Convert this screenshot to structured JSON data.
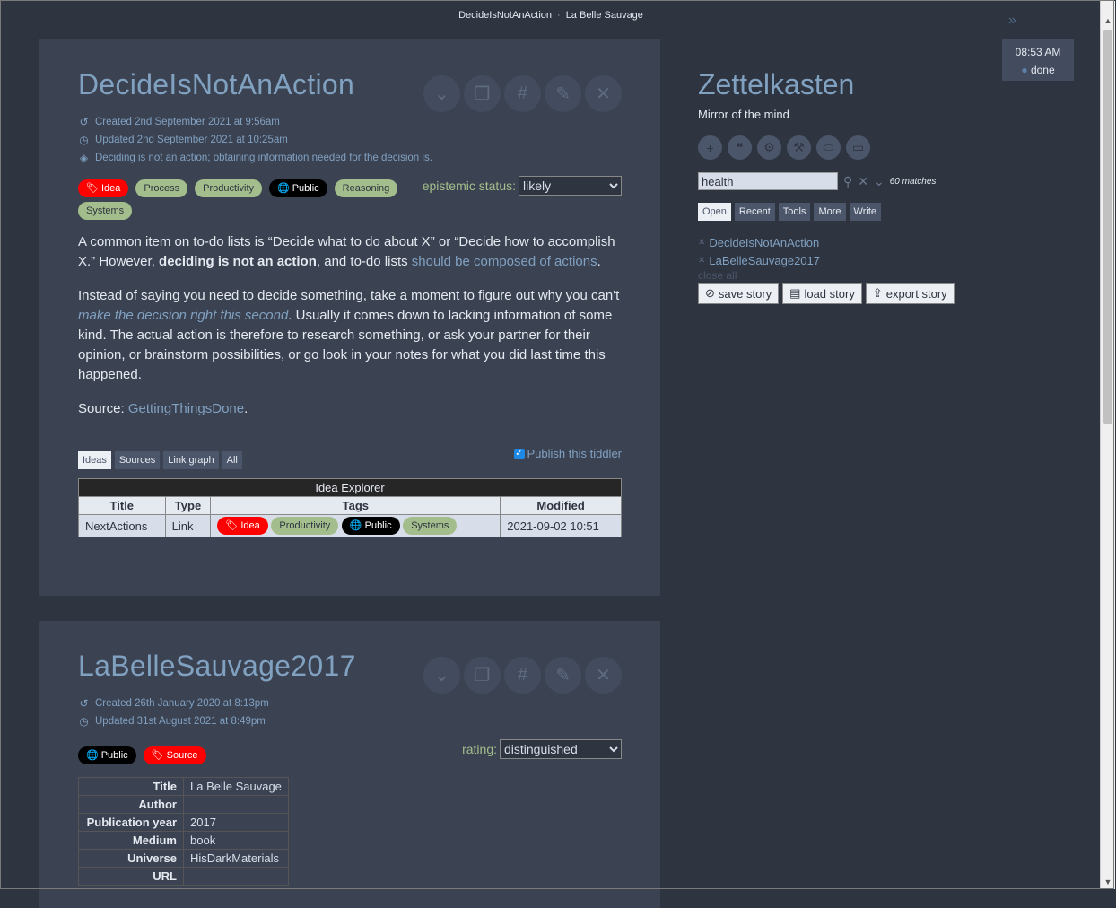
{
  "window": {
    "title_left": "DecideIsNotAnAction",
    "separator": "·",
    "title_right": "La Belle Sauvage"
  },
  "clock": {
    "time": "08:53 AM",
    "status": "done"
  },
  "tiddler1": {
    "title": "DecideIsNotAnAction",
    "created": "Created 2nd September 2021 at 9:56am",
    "updated": "Updated 2nd September 2021 at 10:25am",
    "summary": "Deciding is not an action; obtaining information needed for the decision is.",
    "tags": [
      {
        "label": "Idea",
        "color": "#ff0000"
      },
      {
        "label": "Process",
        "color": "#a3be8c"
      },
      {
        "label": "Productivity",
        "color": "#a3be8c"
      },
      {
        "label": "Public",
        "color": "#000000"
      },
      {
        "label": "Reasoning",
        "color": "#a3be8c"
      },
      {
        "label": "Systems",
        "color": "#a3be8c"
      }
    ],
    "epistemic_label": "epistemic status:",
    "epistemic_value": "likely",
    "p1_a": "A common item on to-do lists is “Decide what to do about X” or “Decide how to accomplish X.” However, ",
    "p1_bold": "deciding is not an action",
    "p1_b": ", and to-do lists ",
    "p1_link": "should be composed of actions",
    "p1_c": ".",
    "p2_a": "Instead of saying you need to decide something, take a moment to figure out why you can't ",
    "p2_link": "make the decision right this second",
    "p2_b": ". Usually it comes down to lacking information of some kind. The actual action is therefore to research something, or ask your partner for their opinion, or brainstorm possibilities, or go look in your notes for what you did last time this happened.",
    "p3_a": "Source: ",
    "p3_link": "GettingThingsDone",
    "p3_b": ".",
    "subtabs": [
      "Ideas",
      "Sources",
      "Link graph",
      "All"
    ],
    "publish_label": "Publish this tiddler",
    "explorer": {
      "caption": "Idea Explorer",
      "headers": [
        "Title",
        "Type",
        "Tags",
        "Modified"
      ],
      "row": {
        "title": "NextActions",
        "type": "Link",
        "tags": [
          "Idea",
          "Productivity",
          "Public",
          "Systems"
        ],
        "modified": "2021-09-02 10:51"
      }
    }
  },
  "tiddler2": {
    "title": "LaBelleSauvage2017",
    "created": "Created 26th January 2020 at 8:13pm",
    "updated": "Updated 31st August 2021 at 8:49pm",
    "tags": [
      {
        "label": "Public",
        "color": "#000000"
      },
      {
        "label": "Source",
        "color": "#ff0000"
      }
    ],
    "rating_label": "rating:",
    "rating_value": "distinguished",
    "info": [
      {
        "key": "Title",
        "value": "La Belle Sauvage"
      },
      {
        "key": "Author",
        "value": ""
      },
      {
        "key": "Publication year",
        "value": "2017"
      },
      {
        "key": "Medium",
        "value": "book"
      },
      {
        "key": "Universe",
        "value": "HisDarkMaterials"
      },
      {
        "key": "URL",
        "value": ""
      }
    ]
  },
  "sidebar": {
    "site_title": "Zettelkasten",
    "site_subtitle": "Mirror of the mind",
    "page_control_icons": [
      "new-tiddler-icon",
      "quote-icon",
      "gear-icon",
      "tools-icon",
      "tag-icon",
      "inbox-icon"
    ],
    "search_value": "health",
    "matches": "60 matches",
    "tabs": [
      "Open",
      "Recent",
      "Tools",
      "More",
      "Write"
    ],
    "open_items": [
      "DecideIsNotAnAction",
      "LaBelleSauvage2017"
    ],
    "close_all": "close all",
    "save_story": "save story",
    "load_story": "load story",
    "export_story": "export story"
  }
}
